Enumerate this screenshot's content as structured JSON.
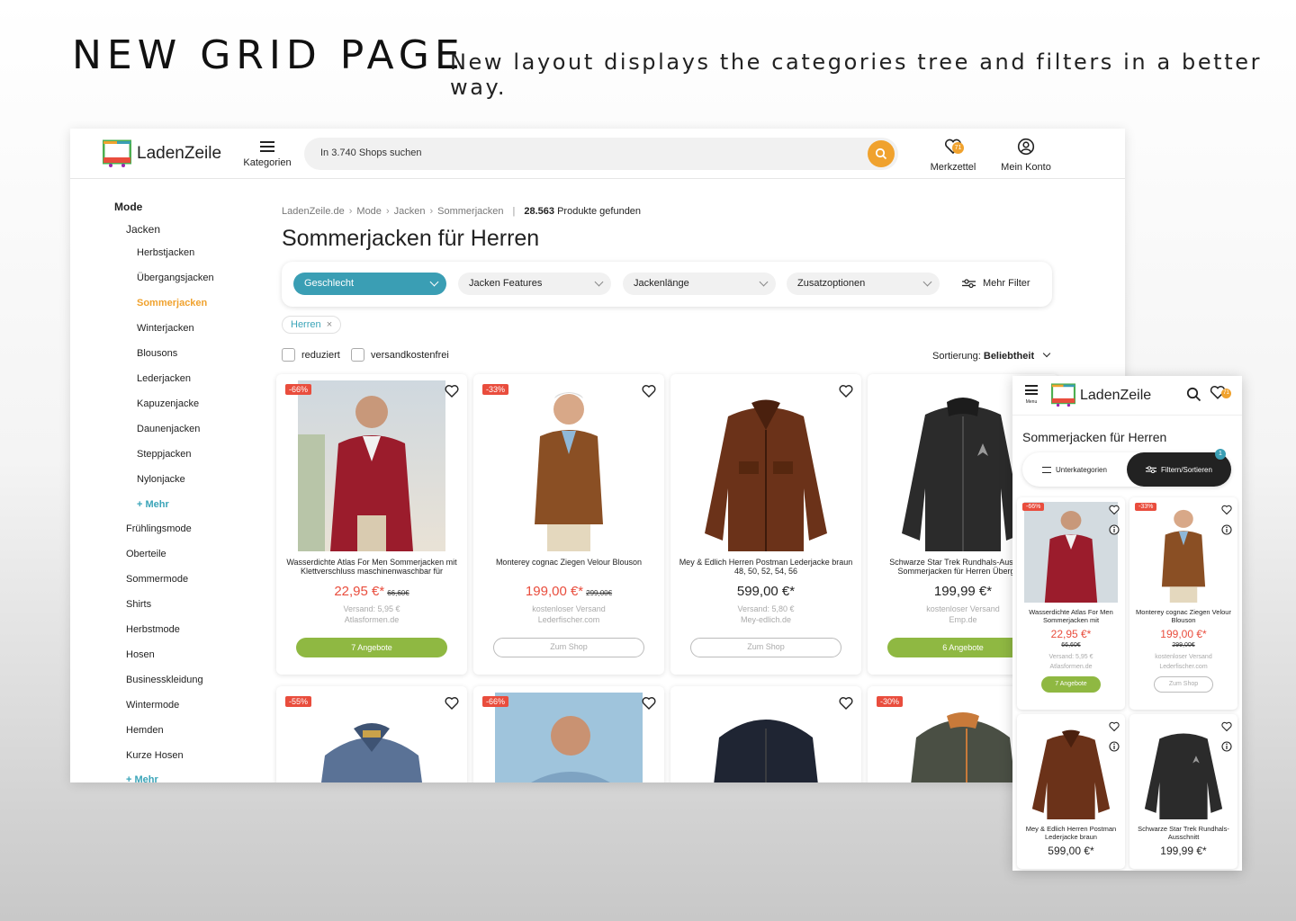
{
  "banner": {
    "title": "NEW GRID PAGE",
    "subtitle": "New layout displays the categories tree and filters in a better way."
  },
  "header": {
    "logo": "LadenZeile",
    "menu_label": "Kategorien",
    "search_placeholder": "In 3.740 Shops suchen",
    "wishlist_label": "Merkzettel",
    "wishlist_count": "71",
    "account_label": "Mein Konto"
  },
  "sidebar": {
    "root": "Mode",
    "category": "Jacken",
    "subcategories": [
      "Herbstjacken",
      "Übergangsjacken",
      "Sommerjacken",
      "Winterjacken",
      "Blousons",
      "Lederjacken",
      "Kapuzenjacke",
      "Daunenjacken",
      "Steppjacken",
      "Nylonjacke"
    ],
    "sub_more": "+ Mehr",
    "siblings": [
      "Frühlingsmode",
      "Oberteile",
      "Sommermode",
      "Shirts",
      "Herbstmode",
      "Hosen",
      "Businesskleidung",
      "Wintermode",
      "Hemden",
      "Kurze Hosen"
    ],
    "more": "+ Mehr"
  },
  "breadcrumb": [
    "LadenZeile.de",
    "Mode",
    "Jacken",
    "Sommerjacken"
  ],
  "results": {
    "count": "28.563",
    "label": "Produkte gefunden"
  },
  "page_title": "Sommerjacken für Herren",
  "filters": [
    "Geschlecht",
    "Jacken Features",
    "Jackenlänge",
    "Zusatzoptionen"
  ],
  "more_filters": "Mehr Filter",
  "active_chip": "Herren",
  "checkboxes": [
    "reduziert",
    "versandkostenfrei"
  ],
  "sort": {
    "label": "Sortierung:",
    "value": "Beliebtheit"
  },
  "products": [
    {
      "discount": "-66%",
      "name": "Wasserdichte Atlas For Men Sommerjacken mit Klettverschluss maschinenwaschbar für",
      "price": "22,95 €*",
      "old_price": "66,60€",
      "shipping": "Versand: 5,95 €",
      "shop": "Atlasformen.de",
      "cta": "7 Angebote"
    },
    {
      "discount": "-33%",
      "name": "Monterey cognac Ziegen Velour Blouson",
      "price": "199,00 €*",
      "old_price": "299,00€",
      "shipping": "kostenloser Versand",
      "shop": "Lederfischer.com",
      "cta": "Zum Shop"
    },
    {
      "discount": "",
      "name": "Mey & Edlich Herren Postman Lederjacke braun 48, 50, 52, 54, 56",
      "price": "599,00 €*",
      "old_price": "",
      "shipping": "Versand: 5,80 €",
      "shop": "Mey-edlich.de",
      "cta": "Zum Shop"
    },
    {
      "discount": "",
      "name": "Schwarze Star Trek Rundhals-Ausschnitt Sommerjacken für Herren Übergang",
      "price": "199,99 €*",
      "old_price": "",
      "shipping": "kostenloser Versand",
      "shop": "Emp.de",
      "cta": "6 Angebote"
    }
  ],
  "row2_discounts": [
    "-55%",
    "-66%",
    "",
    "-30%"
  ],
  "mobile": {
    "menu_label": "Menu",
    "logo": "LadenZeile",
    "wishlist_count": "71",
    "title": "Sommerjacken für Herren",
    "tab_sub": "Unterkategorien",
    "tab_filter": "Filtern/Sortieren",
    "filter_count": "1",
    "cards": [
      {
        "discount": "-66%",
        "name": "Wasserdichte Atlas For Men Sommerjacken mit",
        "price": "22,95 €*",
        "old_price": "66,60€",
        "shipping": "Versand: 5,95 €",
        "shop": "Atlasformen.de",
        "cta": "7 Angebote"
      },
      {
        "discount": "-33%",
        "name": "Monterey cognac Ziegen Velour Blouson",
        "price": "199,00 €*",
        "old_price": "299,00€",
        "shipping": "kostenloser Versand",
        "shop": "Lederfischer.com",
        "cta": "Zum Shop"
      },
      {
        "discount": "",
        "name": "Mey & Edlich Herren Postman Lederjacke braun",
        "price": "599,00 €*"
      },
      {
        "discount": "",
        "name": "Schwarze Star Trek Rundhals-Ausschnitt",
        "price": "199,99 €*"
      }
    ]
  },
  "colors": {
    "accent_orange": "#f0a22e",
    "teal": "#3a9eb4",
    "green": "#8fb842",
    "sale_red": "#e94d3d"
  }
}
